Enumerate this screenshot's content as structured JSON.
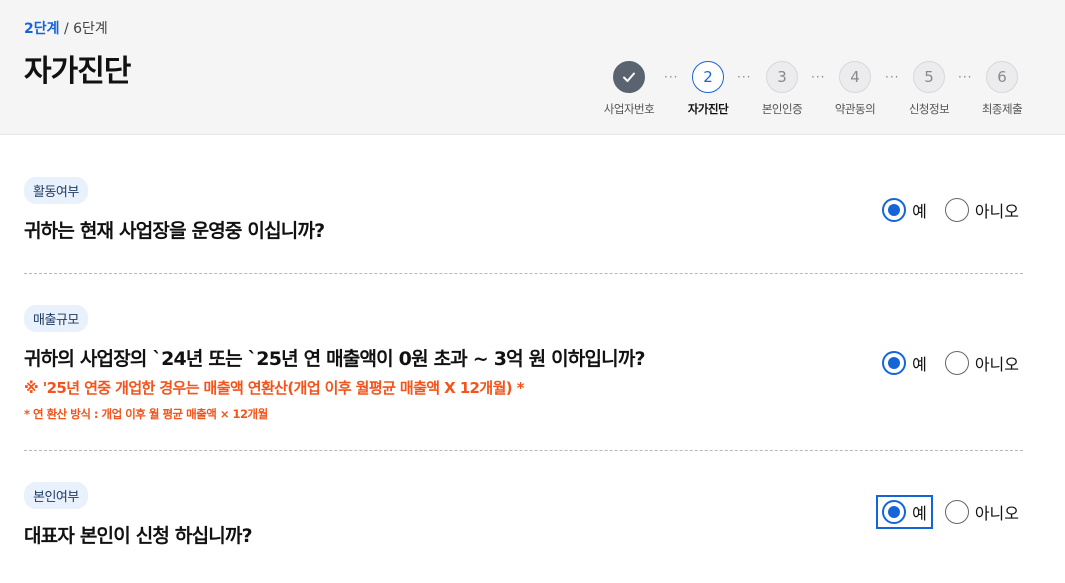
{
  "header": {
    "current_step": "2단계",
    "separator": " / ",
    "total_steps": "6단계",
    "title": "자가진단"
  },
  "stepper": {
    "dots": "···",
    "steps": [
      {
        "number": "",
        "label": "사업자번호",
        "state": "done",
        "icon": "check-icon"
      },
      {
        "number": "2",
        "label": "자가진단",
        "state": "active"
      },
      {
        "number": "3",
        "label": "본인인증",
        "state": "pending"
      },
      {
        "number": "4",
        "label": "약관동의",
        "state": "pending"
      },
      {
        "number": "5",
        "label": "신청정보",
        "state": "pending"
      },
      {
        "number": "6",
        "label": "최종제출",
        "state": "pending"
      }
    ]
  },
  "sections": [
    {
      "badge": "활동여부",
      "question": "귀하는 현재 사업장을 운영중 이십니까?",
      "options": {
        "yes": "예",
        "no": "아니오"
      },
      "selected": "yes"
    },
    {
      "badge": "매출규모",
      "question": "귀하의 사업장의 `24년 또는 `25년 연 매출액이 0원 초과 ~ 3억 원 이하입니까?",
      "note1": "※ '25년 연중 개업한 경우는 매출액 연환산(개업 이후 월평균 매출액 X 12개월) *",
      "note2": "* 연 환산 방식 : 개업 이후 월 평균 매출액 × 12개월",
      "options": {
        "yes": "예",
        "no": "아니오"
      },
      "selected": "yes"
    },
    {
      "badge": "본인여부",
      "question": "대표자 본인이 신청 하십니까?",
      "options": {
        "yes": "예",
        "no": "아니오"
      },
      "selected": "yes"
    }
  ],
  "colors": {
    "accent": "#1565d8",
    "warning": "#f2541b",
    "header_bg": "#f5f5f6",
    "badge_bg": "#e8f1fc"
  }
}
